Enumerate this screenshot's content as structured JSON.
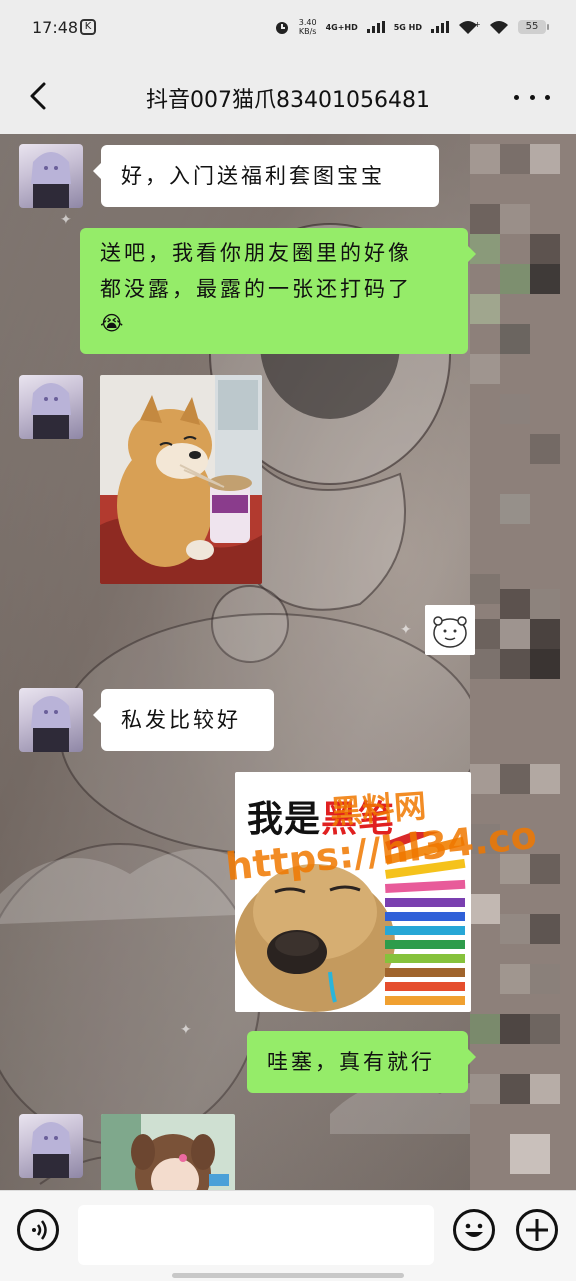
{
  "status_bar": {
    "time": "17:48",
    "speed_value": "3.40",
    "speed_unit": "KB/s",
    "network_1": "4G+HD",
    "network_2": "5G HD",
    "battery": "55"
  },
  "header": {
    "title": "抖音007猫爪83401056481"
  },
  "messages": [
    {
      "side": "left",
      "type": "text",
      "text": "好，入门送福利套图宝宝"
    },
    {
      "side": "right",
      "type": "text",
      "line1": "送吧，我看你朋友圈里的好像",
      "line2": "都没露，最露的一张还打码了",
      "emoji": "😭"
    },
    {
      "side": "left",
      "type": "image",
      "subject": "shiba-dog-eating-noodles"
    },
    {
      "side": "right",
      "type": "sticker",
      "subject": "small-bear-sticker"
    },
    {
      "side": "left",
      "type": "text",
      "text": "私发比较好"
    },
    {
      "side": "right",
      "type": "image",
      "caption_black": "我是",
      "caption_red": "黑笔",
      "watermark_cn": "黑料网",
      "watermark_url": "https://hl34.co"
    },
    {
      "side": "right",
      "type": "text",
      "text": "哇塞，真有就行"
    },
    {
      "side": "left",
      "type": "image",
      "subject": "girl-photo"
    }
  ],
  "colors": {
    "my_bubble": "#95ec69",
    "their_bubble": "#ffffff",
    "watermark": "#f07800"
  },
  "icons": {
    "back": "chevron-left-icon",
    "more": "more-dots-icon",
    "voice": "voice-icon",
    "emoji": "emoji-icon",
    "add": "plus-icon"
  }
}
